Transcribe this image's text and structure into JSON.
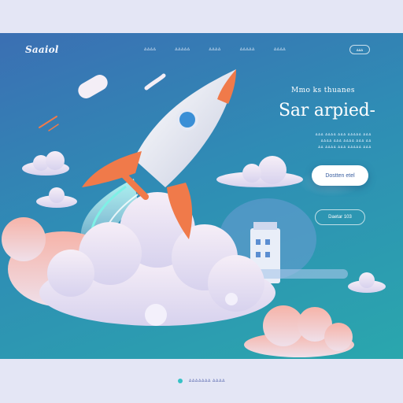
{
  "brand": {
    "logo_text": "Saaiol"
  },
  "nav": {
    "items": [
      {
        "label": "ⵠⵠⵠⵠ"
      },
      {
        "label": "ⵠⵠⵠⵠⵠ"
      },
      {
        "label": "ⵠⵠⵠⵠ"
      },
      {
        "label": "ⵠⵠⵠⵠⵠ"
      },
      {
        "label": "ⵠⵠⵠⵠ"
      }
    ],
    "pill_label": "ⵠⵠⵠ"
  },
  "hero": {
    "kicker": "Mmo ks thuanes",
    "title": "Sar arpied-",
    "description_lines": [
      "ⵠⵠⵠ ⵠⵠⵠⵠ ⵠⵠⵠ ⵠⵠⵠⵠⵠ ⵠⵠⵠ",
      "ⵠⵠⵠⵠ ⵠⵠⵠ ⵠⵠⵠⵠ ⵠⵠⵠ ⵠⵠ",
      "ⵠⵠ ⵠⵠⵠⵠ ⵠⵠⵠ ⵠⵠⵠⵠⵠ ⵠⵠⵠ"
    ],
    "primary_cta": "Dostten etel",
    "secondary_cta": "Daetar 103"
  },
  "footer": {
    "link_text": "ⵠⵠⵠⵠⵠⵠⵠ ⵠⵠⵠⵠ"
  },
  "colors": {
    "background_top": "#3b6fb3",
    "background_bottom": "#2aa7ad",
    "rocket_fin": "#f07a4a",
    "cloud": "#efe8f6",
    "footer_bg": "#e4e6f5",
    "footer_dot": "#36c2c6"
  }
}
